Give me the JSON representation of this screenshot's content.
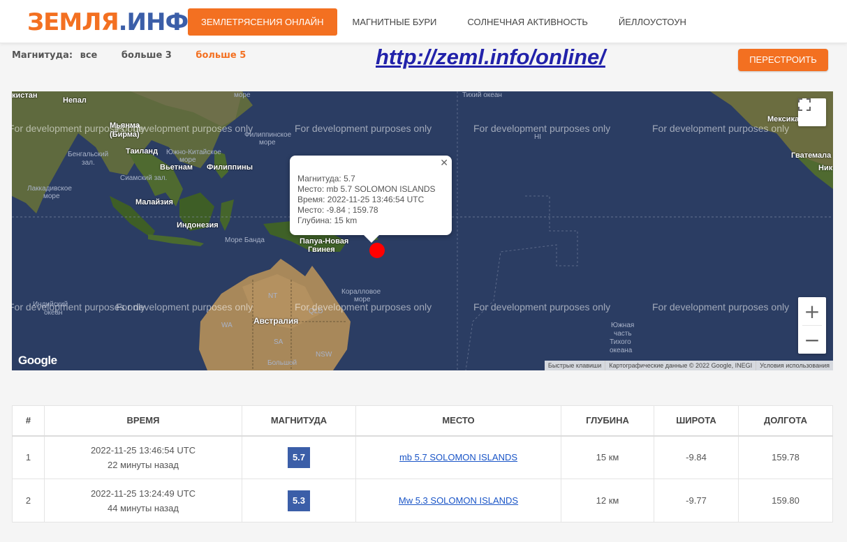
{
  "header": {
    "logo_part1": "ЗЕМЛЯ",
    "logo_part2": ".ИНФО",
    "nav": [
      {
        "label": "ЗЕМЛЕТРЯСЕНИЯ ОНЛАЙН",
        "active": true
      },
      {
        "label": "МАГНИТНЫЕ БУРИ",
        "active": false
      },
      {
        "label": "СОЛНЕЧНАЯ АКТИВНОСТЬ",
        "active": false
      },
      {
        "label": "ЙЕЛЛОУСТОУН",
        "active": false
      }
    ]
  },
  "filter": {
    "label": "Магнитуда:",
    "options": [
      "все",
      "больше 3",
      "больше 5"
    ],
    "selected": "больше 5"
  },
  "url_overlay": "http://zeml.info/online/",
  "rebuild_button": "ПЕРЕСТРОИТЬ",
  "map": {
    "dev_watermark": "For development purposes only",
    "labels": {
      "nepal": "Непал",
      "pakistan": "кистан",
      "myanmar1": "Мьянма",
      "myanmar2": "(Бирма)",
      "thailand": "Таиланд",
      "bengal1": "Бенгальский",
      "bengal2": "зал.",
      "vietnam": "Вьетнам",
      "philippines": "Филиппины",
      "siam": "Сиамский зал.",
      "scs1": "Южно-Китайское",
      "scs2": "море",
      "laccadive1": "Лаккадивское",
      "laccadive2": "море",
      "malaysia": "Малайзия",
      "indonesia": "Индонезия",
      "banda": "Море Банда",
      "png1": "Папуа-Новая",
      "png2": "Гвинея",
      "coral1": "Коралловое",
      "coral2": "море",
      "australia": "Австралия",
      "indian1": "Индийский",
      "indian2": "океан",
      "pacific": "Тихий океан",
      "mexico": "Мексика",
      "guatemala": "Гватемала",
      "nic": "Ник",
      "southpac1": "Южная",
      "southpac2": "часть",
      "southpac3": "Тихого",
      "southpac4": "океана",
      "philsea1": "Филиппинское",
      "philsea2": "море",
      "bight1": "Большой",
      "bight2": "австрал.",
      "more_top": "море",
      "hi": "HI",
      "wa": "WA",
      "nt": "NT",
      "qld": "QLD",
      "sa": "SA",
      "nsw": "NSW"
    },
    "popup": {
      "magnitude": "Магнитуда: 5.7",
      "place": "Место: mb 5.7 SOLOMON ISLANDS",
      "time": "Время: 2022-11-25 13:46:54 UTC",
      "coords": "Место: -9.84 ; 159.78",
      "depth": "Глубина: 15 km"
    },
    "google_logo": "Google",
    "attribution": [
      "Быстрые клавиши",
      "Картографические данные © 2022 Google, INEGI",
      "Условия использования"
    ]
  },
  "table": {
    "headers": [
      "#",
      "ВРЕМЯ",
      "МАГНИТУДА",
      "МЕСТО",
      "ГЛУБИНА",
      "ШИРОТА",
      "ДОЛГОТА"
    ],
    "rows": [
      {
        "n": "1",
        "time": "2022-11-25 13:46:54 UTC",
        "ago": "22 минуты назад",
        "mag": "5.7",
        "place": "mb 5.7 SOLOMON ISLANDS",
        "depth": "15 км",
        "lat": "-9.84",
        "lon": "159.78"
      },
      {
        "n": "2",
        "time": "2022-11-25 13:24:49 UTC",
        "ago": "44 минуты назад",
        "mag": "5.3",
        "place": "Mw 5.3 SOLOMON ISLANDS",
        "depth": "12 км",
        "lat": "-9.77",
        "lon": "159.80"
      }
    ]
  },
  "colors": {
    "accent": "#f37021",
    "brand_blue": "#3b5ea8",
    "quake_marker": "#ff0000",
    "ocean": "#2b3d63"
  }
}
